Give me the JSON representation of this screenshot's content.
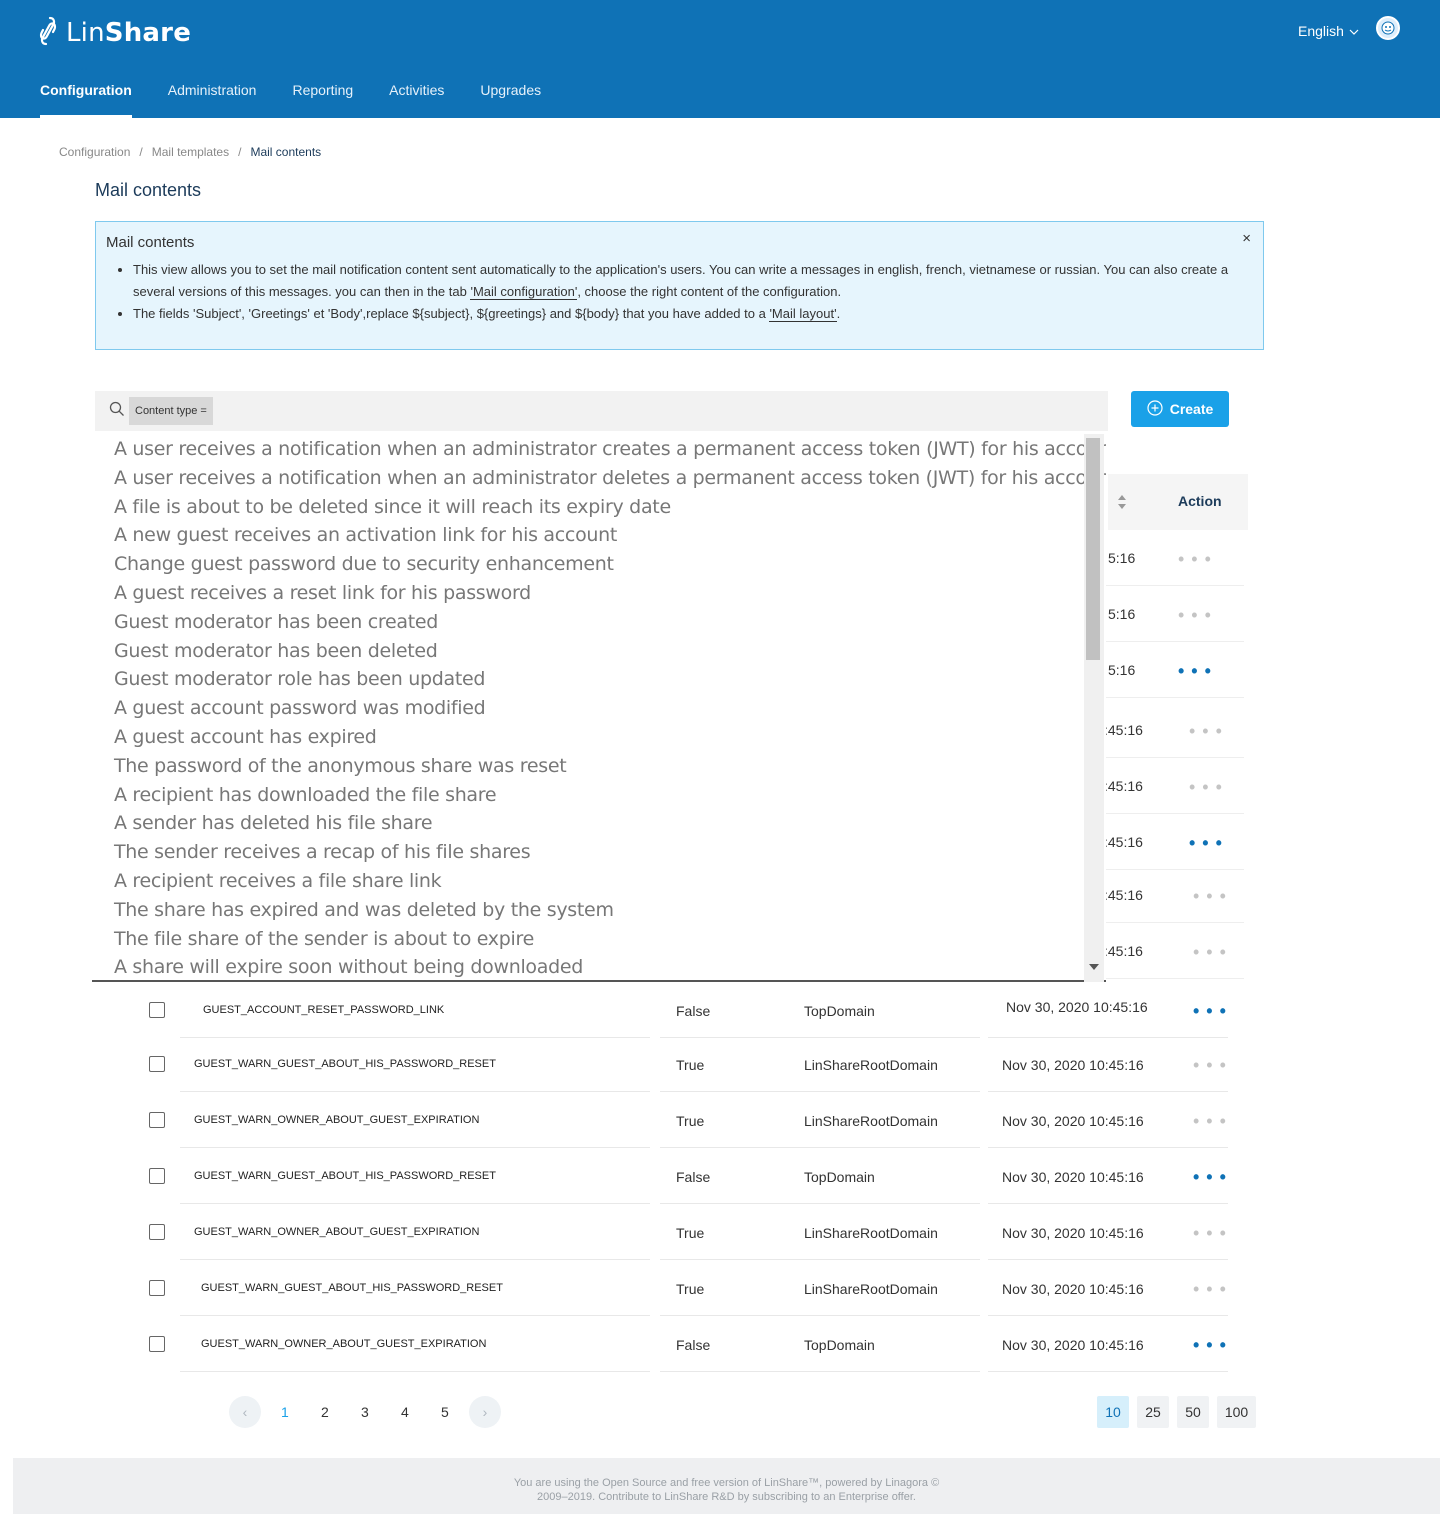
{
  "header": {
    "logo_text_light": "Lin",
    "logo_text_bold": "Share",
    "language": "English",
    "nav": [
      "Configuration",
      "Administration",
      "Reporting",
      "Activities",
      "Upgrades"
    ]
  },
  "breadcrumb": [
    "Configuration",
    "Mail templates",
    "Mail contents"
  ],
  "page_title": "Mail contents",
  "info": {
    "title": "Mail contents",
    "close": "×",
    "b1_text_a": "This view allows you to set the mail notification content sent automatically to the application's users. You can write a messages in english, french, vietnamese or russian. You can also create a several versions of this messages. you can then in the tab ",
    "b1_link": "'Mail configuration'",
    "b1_text_b": ", choose the right content of the configuration.",
    "b2_text_a": "The fields 'Subject', 'Greetings' et 'Body',replace ${subject}, ${greetings} and ${body} that you have added to a ",
    "b2_link": "'Mail layout'",
    "b2_text_b": "."
  },
  "search": {
    "chip": "Content type ="
  },
  "create_label": "Create",
  "table_header": {
    "action": "Action"
  },
  "dropdown_items": [
    "A user receives a notification when an administrator creates a permanent access token (JWT) for his account",
    "A user receives a notification when an administrator deletes a permanent access token (JWT) for his account",
    "A file is about to be deleted since it will reach its expiry date",
    "A new guest receives an activation link for his account",
    "Change guest password due to security enhancement",
    "A guest receives a reset link for his password",
    "Guest moderator has been created",
    "Guest moderator has been deleted",
    "Guest moderator role has been updated",
    "A guest account password was modified",
    "A guest account has expired",
    "The password of the anonymous share was reset",
    "A recipient has downloaded the file share",
    "A sender has deleted his file share",
    "The sender receives a recap of his file shares",
    "A recipient receives a file share link",
    "The share has expired and was deleted by the system",
    "The file share of the sender is about to expire",
    "A share will expire soon without being downloaded"
  ],
  "peek_rows": [
    {
      "time": "5:16",
      "active": false
    },
    {
      "time": "5:16",
      "active": false
    },
    {
      "time": "5:16",
      "active": true
    },
    {
      "time": ":45:16",
      "active": false
    },
    {
      "time": ":45:16",
      "active": false
    },
    {
      "time": ":45:16",
      "active": true
    },
    {
      "time": ":45:16",
      "active": false
    },
    {
      "time": ":45:16",
      "active": false
    }
  ],
  "rows": [
    {
      "name": "GUEST_ACCOUNT_RESET_PASSWORD_LINK",
      "readonly": "False",
      "domain": "TopDomain",
      "date": "Nov 30, 2020 10:45:16",
      "active": true
    },
    {
      "name": "GUEST_WARN_GUEST_ABOUT_HIS_PASSWORD_RESET",
      "readonly": "True",
      "domain": "LinShareRootDomain",
      "date": "Nov 30, 2020 10:45:16",
      "active": false
    },
    {
      "name": "GUEST_WARN_OWNER_ABOUT_GUEST_EXPIRATION",
      "readonly": "True",
      "domain": "LinShareRootDomain",
      "date": "Nov 30, 2020 10:45:16",
      "active": false
    },
    {
      "name": "GUEST_WARN_GUEST_ABOUT_HIS_PASSWORD_RESET",
      "readonly": "False",
      "domain": "TopDomain",
      "date": "Nov 30, 2020 10:45:16",
      "active": true
    },
    {
      "name": "GUEST_WARN_OWNER_ABOUT_GUEST_EXPIRATION",
      "readonly": "True",
      "domain": "LinShareRootDomain",
      "date": "Nov 30, 2020 10:45:16",
      "active": false
    },
    {
      "name": "GUEST_WARN_GUEST_ABOUT_HIS_PASSWORD_RESET",
      "readonly": "True",
      "domain": "LinShareRootDomain",
      "date": "Nov 30, 2020 10:45:16",
      "active": false
    },
    {
      "name": "GUEST_WARN_OWNER_ABOUT_GUEST_EXPIRATION",
      "readonly": "False",
      "domain": "TopDomain",
      "date": "Nov 30, 2020 10:45:16",
      "active": true
    }
  ],
  "dots_glyph": "• • •",
  "pagination": {
    "pages": [
      "1",
      "2",
      "3",
      "4",
      "5"
    ],
    "current": "1",
    "prev": "‹",
    "next": "›",
    "page_sizes": [
      "10",
      "25",
      "50",
      "100"
    ],
    "current_size": "10"
  },
  "footer": {
    "line1": "You are using the Open Source and free version of LinShare™, powered by Linagora ©",
    "line2": "2009–2019. Contribute to LinShare R&D by subscribing to an Enterprise offer."
  },
  "colors": {
    "header_bg": "#0f72b6",
    "accent": "#1aa1e8",
    "info_bg": "#e6f5fd"
  }
}
